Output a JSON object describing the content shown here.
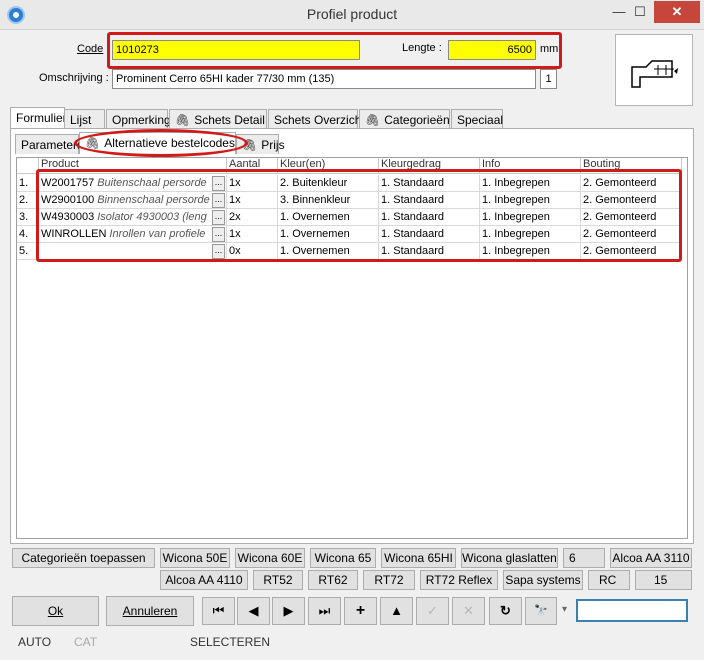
{
  "window": {
    "title": "Profiel product",
    "minimize": "—",
    "maximize": "☐",
    "close": "✕"
  },
  "header": {
    "code_label": "Code",
    "code_value": "1010273",
    "lengte_label": "Lengte :",
    "lengte_value": "6500",
    "lengte_unit": "mm",
    "omschrijving_label": "Omschrijving :",
    "omschrijving_value": "Prominent Cerro 65HI kader 77/30 mm (135)",
    "count_value": "1"
  },
  "main_tabs": [
    "Formulier",
    "Lijst",
    "Opmerking",
    "Schets Detail",
    "Schets Overzicht",
    "Categorieën",
    "Speciaal"
  ],
  "sub_tabs": [
    "Parameters",
    "Alternatieve bestelcodes",
    "Prijs"
  ],
  "grid": {
    "columns": [
      "Product",
      "Aantal",
      "Kleur(en)",
      "Kleurgedrag",
      "Info",
      "Bouting"
    ],
    "rows": [
      {
        "num": "1.",
        "code": "W2001757",
        "desc": "Buitenschaal persorde",
        "aantal": "1x",
        "kleur": "2. Buitenkleur",
        "gedrag": "1. Standaard",
        "info": "1. Inbegrepen",
        "bouting": "2. Gemonteerd"
      },
      {
        "num": "2.",
        "code": "W2900100",
        "desc": "Binnenschaal persorde",
        "aantal": "1x",
        "kleur": "3. Binnenkleur",
        "gedrag": "1. Standaard",
        "info": "1. Inbegrepen",
        "bouting": "2. Gemonteerd"
      },
      {
        "num": "3.",
        "code": "W4930003",
        "desc": "Isolator 4930003 (leng",
        "aantal": "2x",
        "kleur": "1. Overnemen",
        "gedrag": "1. Standaard",
        "info": "1. Inbegrepen",
        "bouting": "2. Gemonteerd"
      },
      {
        "num": "4.",
        "code": "WINROLLEN",
        "desc": "Inrollen van profiele",
        "aantal": "1x",
        "kleur": "1. Overnemen",
        "gedrag": "1. Standaard",
        "info": "1. Inbegrepen",
        "bouting": "2. Gemonteerd"
      },
      {
        "num": "5.",
        "code": "",
        "desc": "",
        "aantal": "0x",
        "kleur": "1. Overnemen",
        "gedrag": "1. Standaard",
        "info": "1. Inbegrepen",
        "bouting": "2. Gemonteerd"
      }
    ],
    "ellipsis": "..."
  },
  "category_buttons": {
    "apply": "Categorieën toepassen",
    "row1": [
      "Wicona 50E",
      "Wicona 60E",
      "Wicona 65",
      "Wicona 65HI",
      "Wicona glaslatten",
      "6",
      "Alcoa AA 3110"
    ],
    "row2": [
      "Alcoa AA 4110",
      "RT52",
      "RT62",
      "RT72",
      "RT72 Reflex",
      "Sapa systems",
      "RC",
      "15"
    ]
  },
  "footer": {
    "ok": "Ok",
    "cancel": "Annuleren",
    "nav": {
      "first": "⏮",
      "prev": "◀",
      "next": "▶",
      "last": "⏭",
      "add": "+",
      "up": "▲",
      "confirm": "✓",
      "discard": "✕",
      "refresh": "↻",
      "find": "🔭",
      "dropdown": "▾"
    },
    "search_value": ""
  },
  "status": {
    "mode": "AUTO",
    "cat": "CAT",
    "action": "SELECTEREN"
  },
  "colors": {
    "highlight": "#ffff00",
    "annotation": "#d11a1a"
  }
}
